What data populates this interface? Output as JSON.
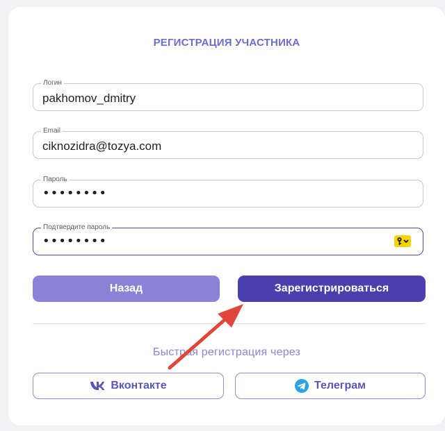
{
  "form": {
    "title": "РЕГИСТРАЦИЯ УЧАСТНИКА",
    "fields": [
      {
        "label": "Логин",
        "value": "pakhomov_dmitry"
      },
      {
        "label": "Email",
        "value": "ciknozidra@tozya.com"
      },
      {
        "label": "Пароль",
        "value": "••••••••"
      },
      {
        "label": "Подтвердите пароль",
        "value": "••••••••"
      }
    ],
    "back_label": "Назад",
    "register_label": "Зарегистрироваться"
  },
  "quick_signup": {
    "title": "Быстрая регистрация через",
    "vk_label": "Вконтакте",
    "telegram_label": "Телеграм"
  },
  "colors": {
    "accent": "#4b3fae",
    "accent_light": "#8883d6",
    "annotation_arrow": "#e0463a"
  },
  "icons": {
    "password_manager": "key-icon",
    "vk": "vk-logo-icon",
    "telegram": "telegram-logo-icon"
  }
}
